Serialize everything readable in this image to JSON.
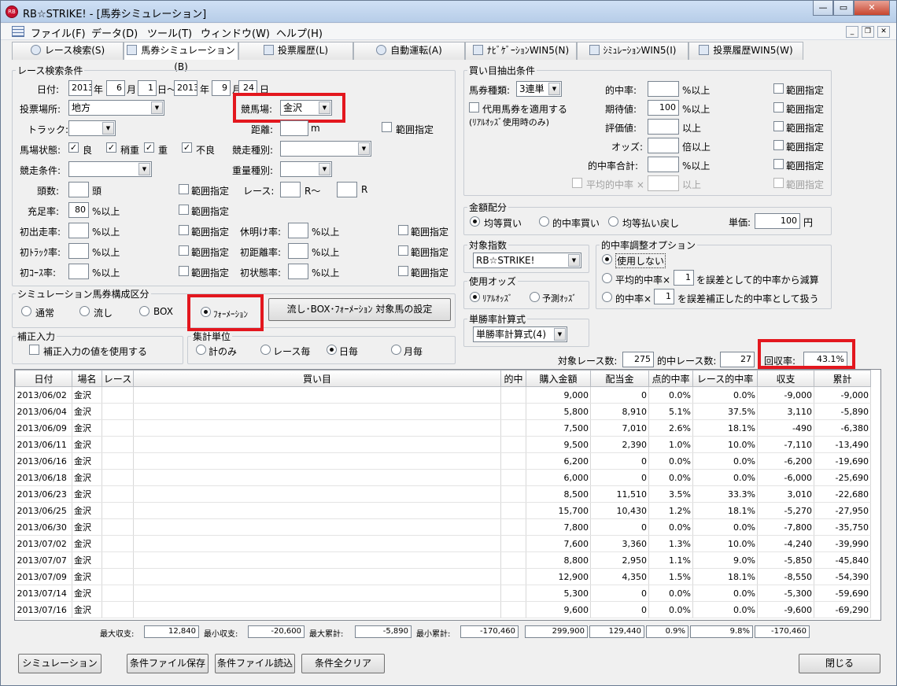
{
  "window": {
    "title": "RB☆STRIKE! - [馬券シミュレーション]",
    "min_btn": "—",
    "max_btn": "▭",
    "close_btn": "✕"
  },
  "menu": [
    {
      "label": "ファイル(F)"
    },
    {
      "label": "データ(D)"
    },
    {
      "label": "ツール(T)"
    },
    {
      "label": "ウィンドウ(W)"
    },
    {
      "label": "ヘルプ(H)"
    }
  ],
  "tabs": [
    {
      "label": "レース検索(S)",
      "icon": "magnifier-icon"
    },
    {
      "label": "馬券シミュレーション(B)",
      "icon": "grid-icon"
    },
    {
      "label": "投票履歴(L)",
      "icon": "document-icon"
    },
    {
      "label": "自動運転(A)",
      "icon": "clock-icon"
    },
    {
      "label": "ﾅﾋﾞｹﾞｰｼｮﾝWIN5(N)",
      "icon": "arrow-icon"
    },
    {
      "label": "ｼﾐｭﾚｰｼｮﾝWIN5(I)",
      "icon": "grid-icon"
    },
    {
      "label": "投票履歴WIN5(W)",
      "icon": "document-icon"
    }
  ],
  "search": {
    "legend": "レース検索条件",
    "date_label": "日付:",
    "date_from": {
      "year": "2013",
      "month": "6",
      "day": "1"
    },
    "date_to": {
      "year": "2013",
      "month": "9",
      "day": "24"
    },
    "u_year": "年",
    "u_month": "月",
    "u_day_from": "日〜",
    "u_day": "日",
    "venue_label": "投票場所:",
    "venue": "地方",
    "course_label": "競馬場:",
    "course": "金沢",
    "track_label": "トラック:",
    "track": "",
    "distance_label": "距離:",
    "distance": "",
    "distance_unit": "m",
    "distance_range": "範囲指定",
    "cond_label": "馬場状態:",
    "cond": [
      "良",
      "稍重",
      "重",
      "不良"
    ],
    "race_type_label": "競走種別:",
    "race_type": "",
    "race_cond_label": "競走条件:",
    "race_cond": "",
    "weight_label": "重量種別:",
    "weight": "",
    "heads_label": "頭数:",
    "heads_unit": "頭",
    "heads_range": "範囲指定",
    "race_label": "レース:",
    "race_from_unit": "R〜",
    "race_to_unit": "R",
    "fill_label": "充足率:",
    "fill": "80",
    "fill_unit": "%以上",
    "fill_range": "範囲指定",
    "rows": [
      {
        "left": "初出走率:",
        "right": "休明け率:"
      },
      {
        "left": "初ﾄﾗｯｸ率:",
        "right": "初距離率:"
      },
      {
        "left": "初ｺｰｽ率:",
        "right": "初状態率:"
      }
    ],
    "pct_unit": "%以上",
    "range": "範囲指定"
  },
  "sim": {
    "legend": "シミュレーション馬券構成区分",
    "options": [
      "通常",
      "流し",
      "BOX",
      "ﾌｫｰﾒｰｼｮﾝ"
    ],
    "selected": 3,
    "setup_btn": "流し･BOX･ﾌｫｰﾒｰｼｮﾝ 対象馬の設定"
  },
  "correction": {
    "legend": "補正入力",
    "checkbox": "補正入力の値を使用する"
  },
  "agg": {
    "legend": "集計単位",
    "options": [
      "計のみ",
      "レース毎",
      "日毎",
      "月毎"
    ],
    "selected": 2
  },
  "buy": {
    "legend": "買い目抽出条件",
    "type_label": "馬券種類:",
    "type": "3連単",
    "substitute": "代用馬券を適用する",
    "substitute_note": "(ﾘｱﾙｵｯｽﾞ使用時のみ)",
    "rows": [
      {
        "label": "的中率:",
        "value": "",
        "unit": "%以上"
      },
      {
        "label": "期待値:",
        "value": "100",
        "unit": "%以上"
      },
      {
        "label": "評価値:",
        "value": "",
        "unit": "以上"
      },
      {
        "label": "オッズ:",
        "value": "",
        "unit": "倍以上"
      },
      {
        "label": "的中率合計:",
        "value": "",
        "unit": "%以上"
      },
      {
        "label": "平均的中率 ×",
        "value": "",
        "unit": "以上"
      }
    ],
    "range": "範囲指定"
  },
  "money": {
    "legend": "金額配分",
    "options": [
      "均等買い",
      "的中率買い",
      "均等払い戻し"
    ],
    "selected": 0,
    "unit_label": "単価:",
    "unit_value": "100",
    "yen": "円"
  },
  "target": {
    "legend": "対象指数",
    "value": "RB☆STRIKE!"
  },
  "odds": {
    "legend": "使用オッズ",
    "options": [
      "ﾘｱﾙｵｯｽﾞ",
      "予測ｵｯｽﾞ"
    ],
    "selected": 0
  },
  "winrate": {
    "legend": "単勝率計算式",
    "value": "単勝率計算式(4)"
  },
  "hitopt": {
    "legend": "的中率調整オプション",
    "opt0": "使用しない",
    "opt1_pre": "平均的中率×",
    "opt1_val": "1",
    "opt1_post": "を誤差として的中率から減算",
    "opt2_pre": "的中率×",
    "opt2_val": "1",
    "opt2_post": "を誤差補正した的中率として扱う",
    "selected": 0
  },
  "summary": {
    "races_label": "対象レース数:",
    "races": "275",
    "hit_label": "的中レース数:",
    "hit": "27",
    "ret_label": "回収率:",
    "ret": "43.1%"
  },
  "table": {
    "headers": [
      "日付",
      "場名",
      "レース",
      "買い目",
      "的中",
      "購入金額",
      "配当金",
      "点的中率",
      "レース的中率",
      "収支",
      "累計"
    ],
    "rows": [
      [
        "2013/06/02",
        "金沢",
        "",
        "",
        "",
        "9,000",
        "0",
        "0.0%",
        "0.0%",
        "-9,000",
        "-9,000"
      ],
      [
        "2013/06/04",
        "金沢",
        "",
        "",
        "",
        "5,800",
        "8,910",
        "5.1%",
        "37.5%",
        "3,110",
        "-5,890"
      ],
      [
        "2013/06/09",
        "金沢",
        "",
        "",
        "",
        "7,500",
        "7,010",
        "2.6%",
        "18.1%",
        "-490",
        "-6,380"
      ],
      [
        "2013/06/11",
        "金沢",
        "",
        "",
        "",
        "9,500",
        "2,390",
        "1.0%",
        "10.0%",
        "-7,110",
        "-13,490"
      ],
      [
        "2013/06/16",
        "金沢",
        "",
        "",
        "",
        "6,200",
        "0",
        "0.0%",
        "0.0%",
        "-6,200",
        "-19,690"
      ],
      [
        "2013/06/18",
        "金沢",
        "",
        "",
        "",
        "6,000",
        "0",
        "0.0%",
        "0.0%",
        "-6,000",
        "-25,690"
      ],
      [
        "2013/06/23",
        "金沢",
        "",
        "",
        "",
        "8,500",
        "11,510",
        "3.5%",
        "33.3%",
        "3,010",
        "-22,680"
      ],
      [
        "2013/06/25",
        "金沢",
        "",
        "",
        "",
        "15,700",
        "10,430",
        "1.2%",
        "18.1%",
        "-5,270",
        "-27,950"
      ],
      [
        "2013/06/30",
        "金沢",
        "",
        "",
        "",
        "7,800",
        "0",
        "0.0%",
        "0.0%",
        "-7,800",
        "-35,750"
      ],
      [
        "2013/07/02",
        "金沢",
        "",
        "",
        "",
        "7,600",
        "3,360",
        "1.3%",
        "10.0%",
        "-4,240",
        "-39,990"
      ],
      [
        "2013/07/07",
        "金沢",
        "",
        "",
        "",
        "8,800",
        "2,950",
        "1.1%",
        "9.0%",
        "-5,850",
        "-45,840"
      ],
      [
        "2013/07/09",
        "金沢",
        "",
        "",
        "",
        "12,900",
        "4,350",
        "1.5%",
        "18.1%",
        "-8,550",
        "-54,390"
      ],
      [
        "2013/07/14",
        "金沢",
        "",
        "",
        "",
        "5,300",
        "0",
        "0.0%",
        "0.0%",
        "-5,300",
        "-59,690"
      ],
      [
        "2013/07/16",
        "金沢",
        "",
        "",
        "",
        "9,600",
        "0",
        "0.0%",
        "0.0%",
        "-9,600",
        "-69,290"
      ]
    ]
  },
  "footer": {
    "max_label": "最大収支:",
    "max": "12,840",
    "min_label": "最小収支:",
    "min": "-20,600",
    "maxcum_label": "最大累計:",
    "maxcum": "-5,890",
    "mincum_label": "最小累計:",
    "mincum": "-170,460",
    "total_buy": "299,900",
    "total_pay": "129,440",
    "total_pt": "0.9%",
    "total_race": "9.8%",
    "total_bal": "-170,460"
  },
  "buttons": {
    "simulate": "シミュレーション",
    "save": "条件ファイル保存",
    "load": "条件ファイル読込",
    "clear": "条件全クリア",
    "close": "閉じる"
  },
  "colors": {
    "highlight": "#e3171e",
    "title_bg": "#c6d9f1"
  }
}
